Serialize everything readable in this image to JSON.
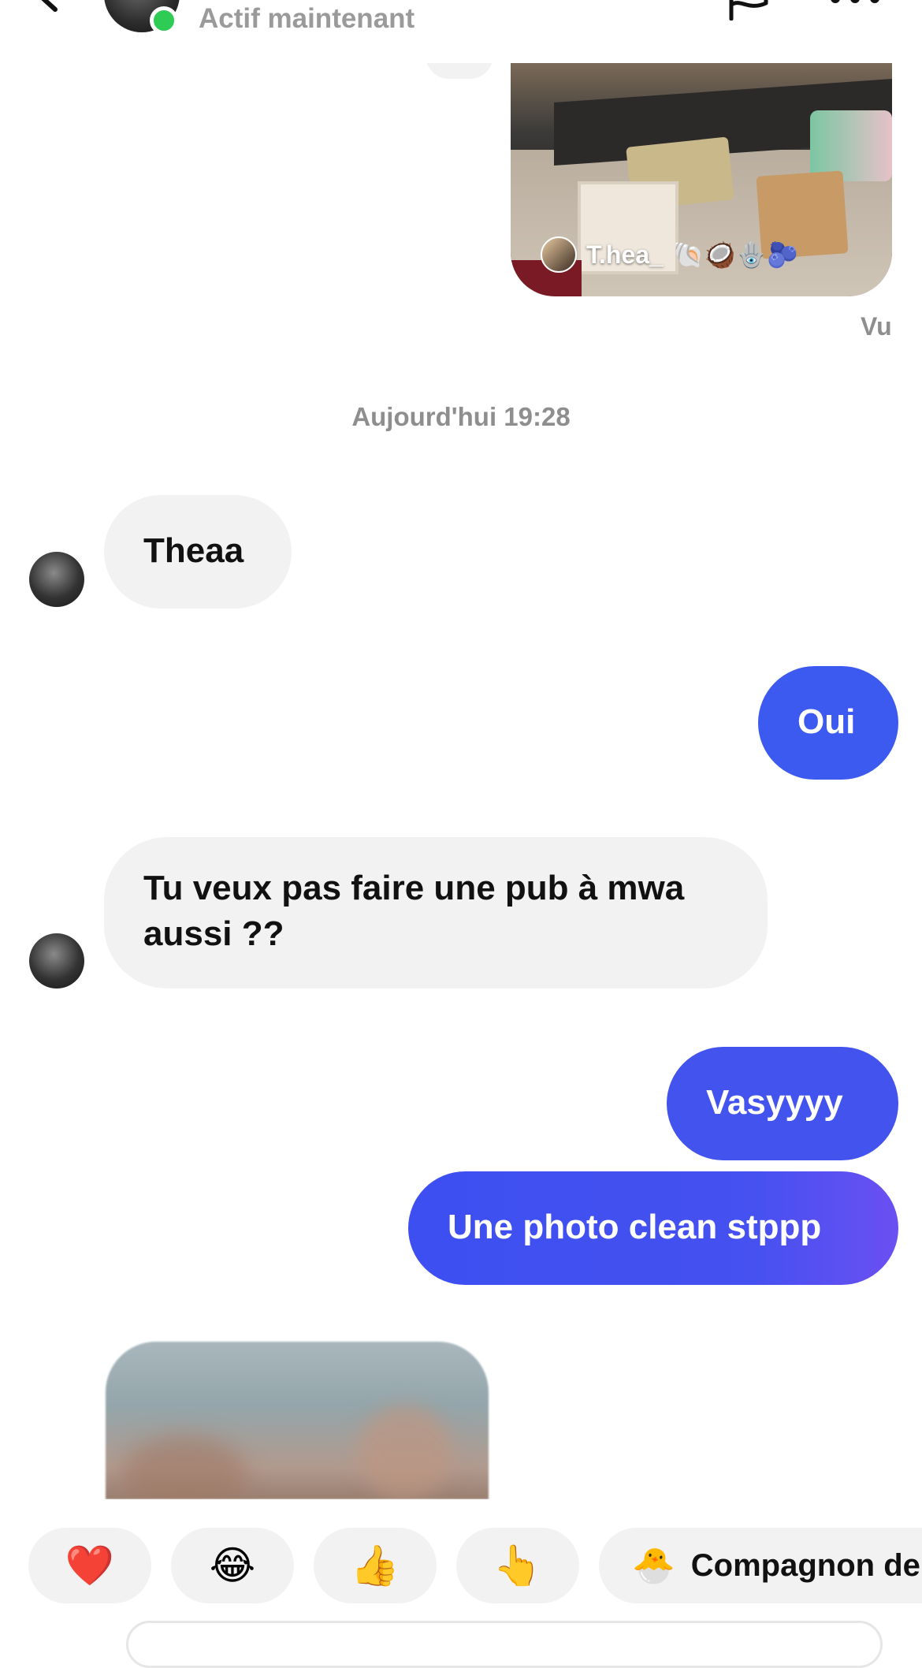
{
  "header": {
    "status": "Actif maintenant",
    "icons": [
      "back-icon",
      "flag-icon",
      "more-icon"
    ]
  },
  "shared_post": {
    "username": "T.hea_",
    "emojis": "🐚🥥🪬🫐"
  },
  "seen_label": "Vu",
  "timestamp": "Aujourd'hui 19:28",
  "messages": [
    {
      "side": "received",
      "text": "Theaa"
    },
    {
      "side": "sent",
      "text": "Oui"
    },
    {
      "side": "received",
      "text": "Tu veux pas faire une pub à mwa aussi ??"
    },
    {
      "side": "sent",
      "text": "Vasyyyy"
    },
    {
      "side": "sent",
      "text": "Une photo clean stppp"
    }
  ],
  "quick_reactions": [
    "❤️",
    "😂",
    "👍",
    "👆"
  ],
  "suggestion_chip": {
    "emoji": "🐣",
    "label": "Compagnon de"
  },
  "colors": {
    "sent_bubble": "#3d5af0",
    "received_bubble": "#f2f2f2",
    "online_dot": "#2ecc55"
  }
}
